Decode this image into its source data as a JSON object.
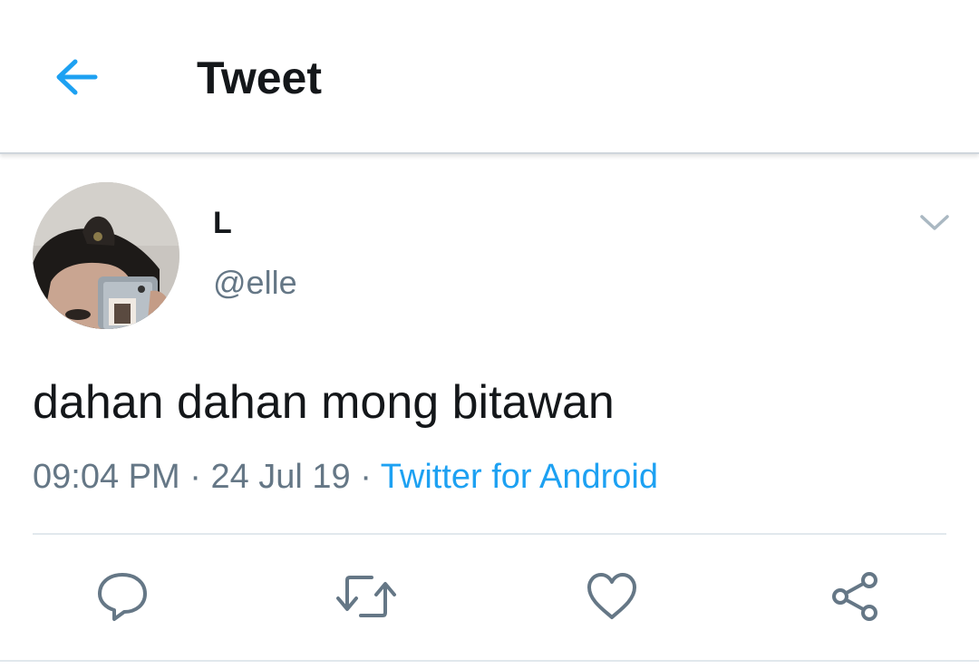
{
  "header": {
    "title": "Tweet",
    "back_icon": "arrow-left-icon"
  },
  "tweet": {
    "display_name": "L",
    "handle": "@elle",
    "text": "dahan dahan mong bitawan",
    "time": "09:04 PM",
    "date": "24 Jul 19",
    "source": "Twitter for Android",
    "separator": "·"
  },
  "actions": {
    "reply_icon": "reply-icon",
    "retweet_icon": "retweet-icon",
    "like_icon": "heart-icon",
    "share_icon": "share-icon"
  },
  "colors": {
    "accent": "#1da1f2",
    "secondary_text": "#657786",
    "icon": "#657786",
    "primary_text": "#14171a"
  }
}
